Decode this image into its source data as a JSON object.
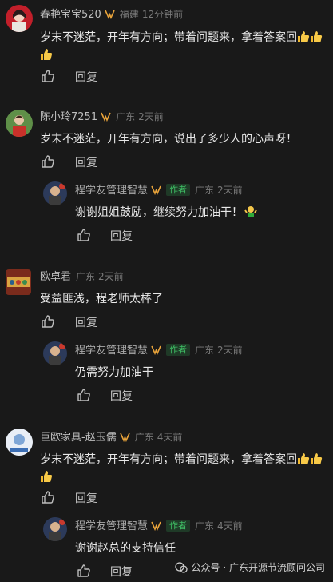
{
  "comments": [
    {
      "name": "春艳宝宝520",
      "location": "福建",
      "time": "12分钟前",
      "line1": "岁末不迷茫，开年有方向；带着问题来，拿着答案回",
      "emoji_count": 3,
      "reply_label": "回复"
    },
    {
      "name": "陈小玲7251",
      "location": "广东",
      "time": "2天前",
      "line1": "岁末不迷茫，开年有方向，说出了多少人的心声呀！",
      "reply_label": "回复",
      "author_reply": {
        "name": "程学友管理智慧",
        "badge": "作者",
        "location": "广东",
        "time": "2天前",
        "text": "谢谢姐姐鼓励，继续努力加油干！",
        "reply_label": "回复"
      }
    },
    {
      "name": "欧卓君",
      "location": "广东",
      "time": "2天前",
      "line1": "受益匪浅，程老师太棒了",
      "reply_label": "回复",
      "author_reply": {
        "name": "程学友管理智慧",
        "badge": "作者",
        "location": "广东",
        "time": "2天前",
        "text": "仍需努力加油干",
        "reply_label": "回复"
      }
    },
    {
      "name": "巨欧家具-赵玉儒",
      "location": "广东",
      "time": "4天前",
      "line1": "岁末不迷茫，开年有方向；带着问题来，拿着答案回",
      "emoji_count": 3,
      "reply_label": "回复",
      "author_reply": {
        "name": "程学友管理智慧",
        "badge": "作者",
        "location": "广东",
        "time": "4天前",
        "text": "谢谢赵总的支持信任",
        "reply_label": "回复"
      }
    }
  ],
  "watermark": "公众号 · 广东开源节流顾问公司",
  "colors": {
    "background": "#191919",
    "author_badge": "#3fbf65"
  }
}
